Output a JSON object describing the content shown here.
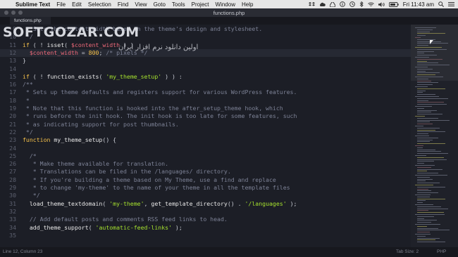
{
  "menubar": {
    "app_name": "Sublime Text",
    "items": [
      "File",
      "Edit",
      "Selection",
      "Find",
      "View",
      "Goto",
      "Tools",
      "Project",
      "Window",
      "Help"
    ],
    "clock": "Fri 11:43 am"
  },
  "window": {
    "title": "functions.php"
  },
  "tabs": [
    {
      "label": "functions.php"
    }
  ],
  "watermark": {
    "text": "SOFTGOZAR.COM",
    "subtext": "اولین دانلود نرم افزار ایران"
  },
  "editor": {
    "current_line": 12,
    "lines": [
      {
        "n": "9",
        "t": [
          [
            "comment",
            " * Sets the content width based on the theme's design and stylesheet."
          ]
        ]
      },
      {
        "n": "10",
        "t": [
          [
            "comment",
            " */"
          ]
        ]
      },
      {
        "n": "11",
        "t": [
          [
            "kw",
            "if"
          ],
          [
            "plain",
            " ( ! "
          ],
          [
            "fn",
            "isset"
          ],
          [
            "plain",
            "( "
          ],
          [
            "var",
            "$content_width"
          ],
          [
            "plain",
            " ) )"
          ]
        ]
      },
      {
        "n": "12",
        "t": [
          [
            "plain",
            "  "
          ],
          [
            "var",
            "$content_width"
          ],
          [
            "plain",
            " = "
          ],
          [
            "num",
            "800"
          ],
          [
            "plain",
            "; "
          ],
          [
            "comment",
            "/* pixels */"
          ]
        ]
      },
      {
        "n": "13",
        "t": [
          [
            "plain",
            "}"
          ]
        ]
      },
      {
        "n": "14",
        "t": []
      },
      {
        "n": "15",
        "t": [
          [
            "kw",
            "if"
          ],
          [
            "plain",
            " ( ! "
          ],
          [
            "fn",
            "function_exists"
          ],
          [
            "plain",
            "( "
          ],
          [
            "str",
            "'my_theme_setup'"
          ],
          [
            "plain",
            " ) ) :"
          ]
        ]
      },
      {
        "n": "16",
        "t": [
          [
            "comment",
            "/**"
          ]
        ]
      },
      {
        "n": "17",
        "t": [
          [
            "comment",
            " * Sets up theme defaults and registers support for various WordPress features."
          ]
        ]
      },
      {
        "n": "18",
        "t": [
          [
            "comment",
            " *"
          ]
        ]
      },
      {
        "n": "19",
        "t": [
          [
            "comment",
            " * Note that this function is hooked into the after_setup_theme hook, which"
          ]
        ]
      },
      {
        "n": "20",
        "t": [
          [
            "comment",
            " * runs before the init hook. The init hook is too late for some features, such"
          ]
        ]
      },
      {
        "n": "21",
        "t": [
          [
            "comment",
            " * as indicating support for post thumbnails."
          ]
        ]
      },
      {
        "n": "22",
        "t": [
          [
            "comment",
            " */"
          ]
        ]
      },
      {
        "n": "23",
        "t": [
          [
            "kw",
            "function"
          ],
          [
            "plain",
            " "
          ],
          [
            "fn",
            "my_theme_setup"
          ],
          [
            "plain",
            "() {"
          ]
        ]
      },
      {
        "n": "24",
        "t": []
      },
      {
        "n": "25",
        "t": [
          [
            "comment",
            "  /*"
          ]
        ]
      },
      {
        "n": "26",
        "t": [
          [
            "comment",
            "   * Make theme available for translation."
          ]
        ]
      },
      {
        "n": "27",
        "t": [
          [
            "comment",
            "   * Translations can be filed in the /languages/ directory."
          ]
        ]
      },
      {
        "n": "28",
        "t": [
          [
            "comment",
            "   * If you're building a theme based on My Theme, use a find and replace"
          ]
        ]
      },
      {
        "n": "29",
        "t": [
          [
            "comment",
            "   * to change 'my-theme' to the name of your theme in all the template files"
          ]
        ]
      },
      {
        "n": "30",
        "t": [
          [
            "comment",
            "   */"
          ]
        ]
      },
      {
        "n": "31",
        "t": [
          [
            "plain",
            "  "
          ],
          [
            "fn",
            "load_theme_textdomain"
          ],
          [
            "plain",
            "( "
          ],
          [
            "str",
            "'my-theme'"
          ],
          [
            "plain",
            ", "
          ],
          [
            "fn",
            "get_template_directory"
          ],
          [
            "plain",
            "() . "
          ],
          [
            "str",
            "'/languages'"
          ],
          [
            "plain",
            " );"
          ]
        ]
      },
      {
        "n": "32",
        "t": []
      },
      {
        "n": "33",
        "t": [
          [
            "comment",
            "  // Add default posts and comments RSS feed links to head."
          ]
        ]
      },
      {
        "n": "34",
        "t": [
          [
            "plain",
            "  "
          ],
          [
            "fn",
            "add_theme_support"
          ],
          [
            "plain",
            "( "
          ],
          [
            "str",
            "'automatic-feed-links'"
          ],
          [
            "plain",
            " );"
          ]
        ]
      },
      {
        "n": "35",
        "t": []
      }
    ]
  },
  "statusbar": {
    "position": "Line 12, Column 23",
    "tab_size": "Tab Size: 2",
    "syntax": "PHP"
  },
  "colors": {
    "background": "#1c1e26",
    "keyword": "#f5c04a",
    "string": "#a6e22e",
    "variable": "#ef6a7a",
    "comment": "#7d8296"
  }
}
